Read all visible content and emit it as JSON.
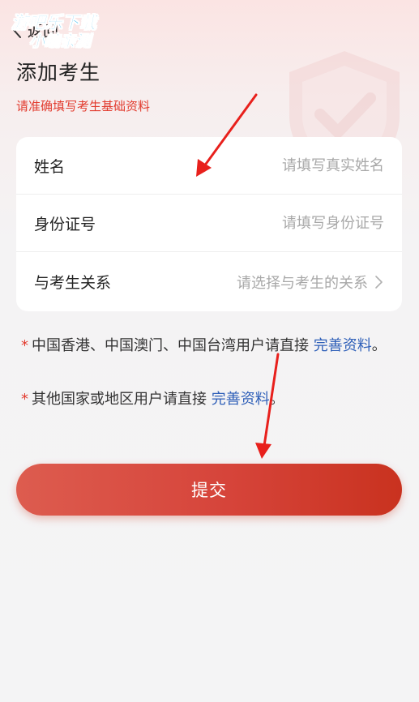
{
  "watermark": {
    "line1": "游吧乐下载",
    "line2": "小编亲测"
  },
  "header": {
    "back_label": "返回"
  },
  "page": {
    "title": "添加考生",
    "hint": "请准确填写考生基础资料"
  },
  "form": {
    "name": {
      "label": "姓名",
      "placeholder": "请填写真实姓名",
      "value": ""
    },
    "id_number": {
      "label": "身份证号",
      "placeholder": "请填写身份证号",
      "value": ""
    },
    "relation": {
      "label": "与考生关系",
      "selected": "请选择与考生的关系"
    }
  },
  "notes": {
    "note1": {
      "star": "*",
      "text": "中国香港、中国澳门、中国台湾用户请直接",
      "link": "完善资料",
      "end": "。"
    },
    "note2": {
      "star": "*",
      "text": "其他国家或地区用户请直接",
      "link": "完善资料",
      "end": "。"
    }
  },
  "submit": {
    "label": "提交"
  },
  "colors": {
    "accent_red": "#e23b2e",
    "link_blue": "#2e5fb8",
    "button_gradient_start": "#dd5c4f",
    "button_gradient_end": "#c9321f",
    "annotation_arrow": "#e8201c"
  },
  "icons": {
    "back": "chevron-left-icon",
    "select_arrow": "chevron-right-icon",
    "background": "shield-check-icon"
  }
}
